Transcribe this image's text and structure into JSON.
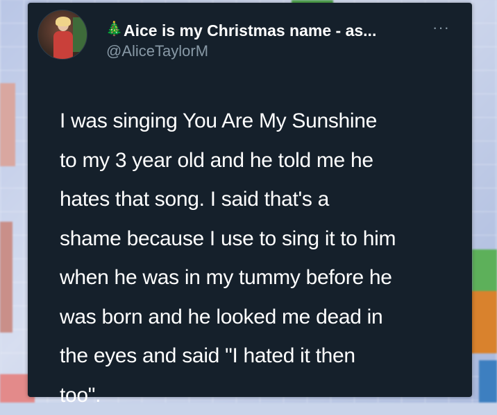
{
  "author": {
    "display_name": "Aice is my Christmas name - as...",
    "handle": "@AliceTaylorM",
    "name_emoji": "christmas-tree-icon"
  },
  "tweet": {
    "text": "I was singing You Are My Sunshine\nto my 3 year old and he told me he\nhates that song. I said that's a\nshame because I use to sing it to him\nwhen he was in my tummy before he\nwas born and he looked me dead in\nthe eyes and said \"I hated it then\ntoo\"."
  },
  "colors": {
    "card_background": "#15202b",
    "primary_text": "#ffffff",
    "secondary_text": "#8899a6"
  }
}
